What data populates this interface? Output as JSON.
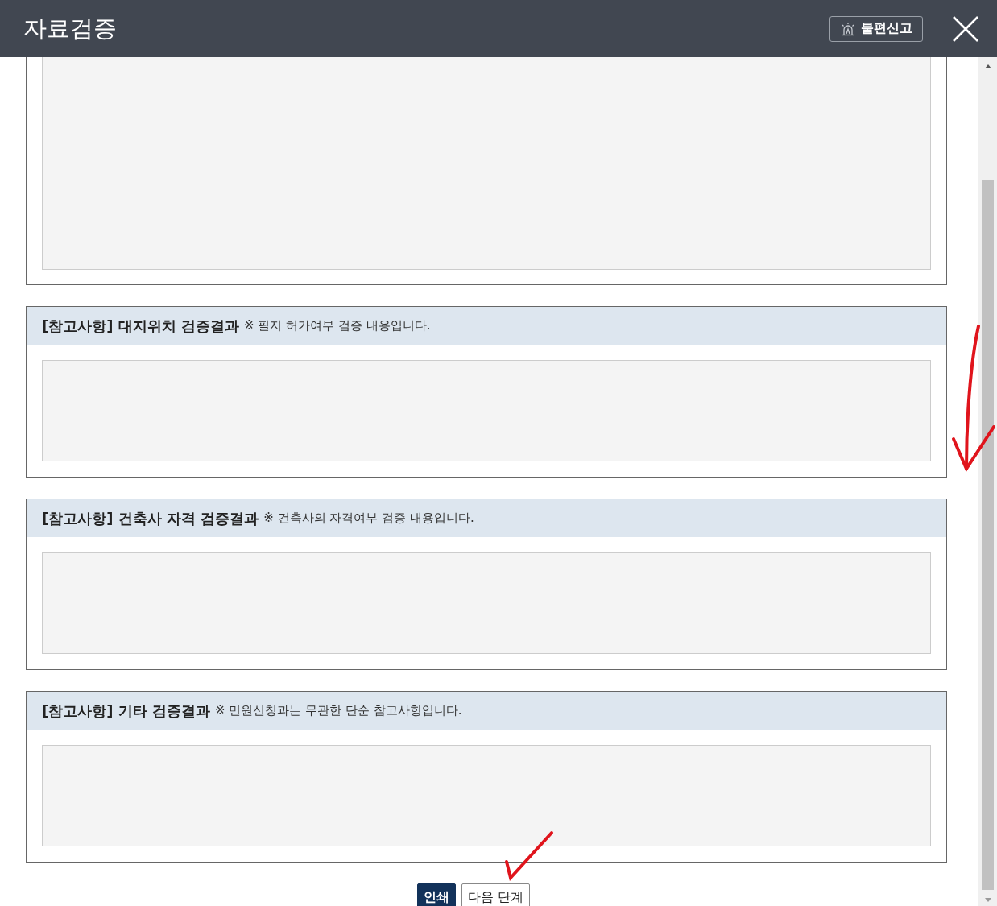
{
  "window": {
    "title": "자료검증",
    "report_button": "불편신고"
  },
  "sections": [
    {
      "heading": "[참고사항] 대지위치 검증결과",
      "note": "※ 필지 허가여부 검증 내용입니다."
    },
    {
      "heading": "[참고사항] 건축사 자격 검증결과",
      "note": "※ 건축사의 자격여부 검증 내용입니다."
    },
    {
      "heading": "[참고사항] 기타 검증결과",
      "note": "※ 민원신청과는 무관한 단순 참고사항입니다."
    }
  ],
  "buttons": [
    {
      "label": "인쇄",
      "kind": "primary"
    },
    {
      "label": "다음 단계",
      "kind": "secondary"
    }
  ]
}
